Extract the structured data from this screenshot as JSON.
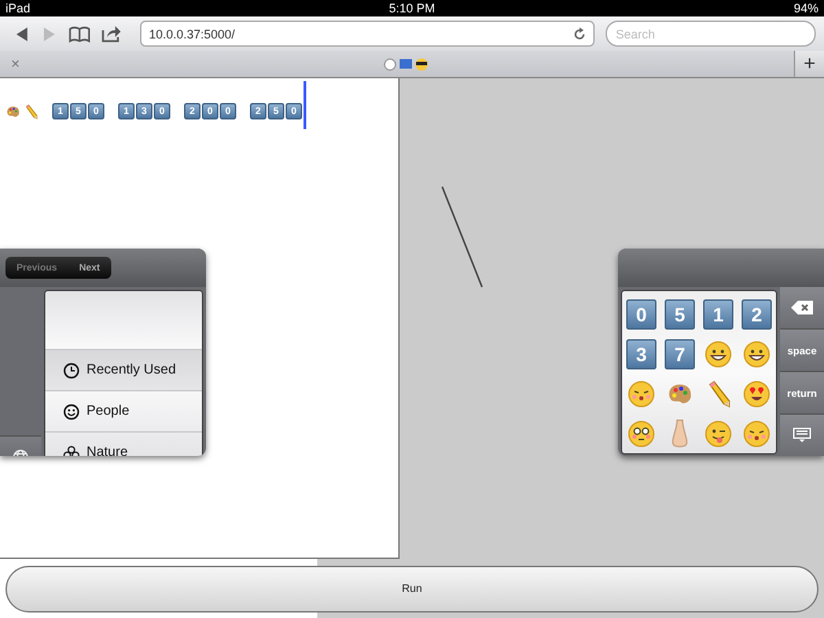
{
  "status_bar": {
    "device": "iPad",
    "time": "5:10 PM",
    "battery": "94%"
  },
  "toolbar": {
    "url": "10.0.0.37:5000/",
    "search": {
      "placeholder": "Search"
    }
  },
  "tab_bar": {
    "close": "×",
    "add": "+"
  },
  "editor": {
    "keycap_groups": [
      [
        "1",
        "5",
        "0"
      ],
      [
        "1",
        "3",
        "0"
      ],
      [
        "2",
        "0",
        "0"
      ],
      [
        "2",
        "5",
        "0"
      ]
    ]
  },
  "keyboard_left": {
    "buttons": [
      {
        "label": "Previous",
        "disabled": true
      },
      {
        "label": "Next",
        "disabled": false
      }
    ],
    "categories": [
      {
        "label": "Recently Used",
        "selected": true
      },
      {
        "label": "People",
        "selected": false
      },
      {
        "label": "Nature",
        "selected": false
      }
    ]
  },
  "keyboard_right": {
    "keys": [
      {
        "kind": "keycap",
        "label": "0"
      },
      {
        "kind": "keycap",
        "label": "5"
      },
      {
        "kind": "keycap",
        "label": "1"
      },
      {
        "kind": "keycap",
        "label": "2"
      },
      {
        "kind": "keycap",
        "label": "3"
      },
      {
        "kind": "keycap",
        "label": "7"
      },
      {
        "kind": "grin"
      },
      {
        "kind": "grin"
      },
      {
        "kind": "kiss"
      },
      {
        "kind": "palette"
      },
      {
        "kind": "pencil"
      },
      {
        "kind": "hearteyes"
      },
      {
        "kind": "flushed"
      },
      {
        "kind": "nose"
      },
      {
        "kind": "tongue"
      },
      {
        "kind": "kiss"
      }
    ],
    "space": "space",
    "return": "return"
  },
  "run_button": "Run"
}
